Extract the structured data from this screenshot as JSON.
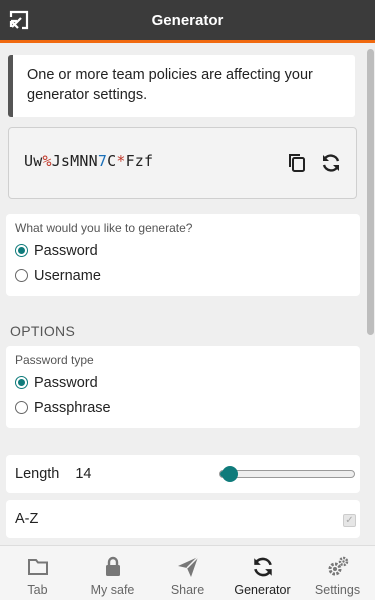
{
  "header": {
    "title": "Generator",
    "popout_icon": "popout-icon"
  },
  "policy_notice": "One or more team policies are affecting your generator settings.",
  "generated": {
    "parts": [
      {
        "text": "Uw",
        "kind": "char"
      },
      {
        "text": "%",
        "kind": "sym"
      },
      {
        "text": "JsMNN",
        "kind": "char"
      },
      {
        "text": "7",
        "kind": "num"
      },
      {
        "text": "C",
        "kind": "char"
      },
      {
        "text": "*",
        "kind": "sym"
      },
      {
        "text": "Fzf",
        "kind": "char"
      }
    ]
  },
  "generate_type": {
    "question": "What would you like to generate?",
    "options": [
      {
        "label": "Password",
        "checked": true
      },
      {
        "label": "Username",
        "checked": false
      }
    ]
  },
  "options_title": "OPTIONS",
  "password_type": {
    "label": "Password type",
    "options": [
      {
        "label": "Password",
        "checked": true
      },
      {
        "label": "Passphrase",
        "checked": false
      }
    ]
  },
  "length": {
    "label": "Length",
    "value": "14",
    "min": 5,
    "max": 128
  },
  "az": {
    "label": "A-Z",
    "checked": true,
    "disabled": true
  },
  "colors": {
    "accent": "#0f7b7b",
    "header_bg": "#3b3b3b",
    "header_border": "#f0690f"
  },
  "tabs": [
    {
      "label": "Tab",
      "icon": "folder-icon",
      "active": false
    },
    {
      "label": "My safe",
      "icon": "lock-icon",
      "active": false
    },
    {
      "label": "Share",
      "icon": "send-icon",
      "active": false
    },
    {
      "label": "Generator",
      "icon": "refresh-icon",
      "active": true
    },
    {
      "label": "Settings",
      "icon": "gears-icon",
      "active": false
    }
  ]
}
